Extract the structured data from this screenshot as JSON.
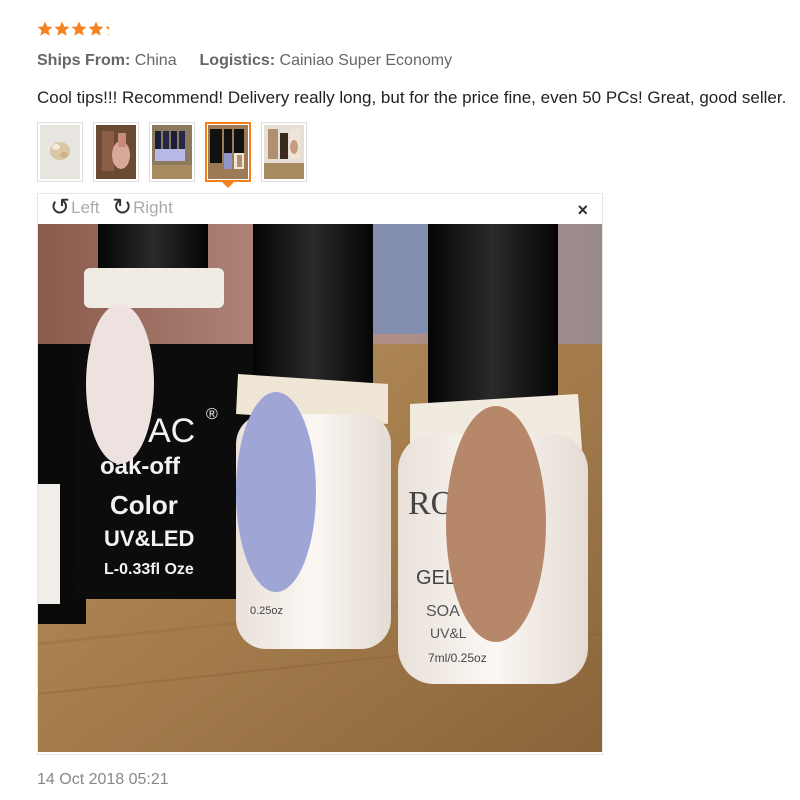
{
  "review": {
    "rating": 4.25,
    "ships_from_label": "Ships From:",
    "ships_from_value": "China",
    "logistics_label": "Logistics:",
    "logistics_value": "Cainiao Super Economy",
    "text": "Cool tips!!! Recommend! Delivery really long, but for the price fine, even 50 PCs! Great, good seller.",
    "date": "14 Oct 2018 05:21"
  },
  "viewer": {
    "rotate_left_label": "Left",
    "rotate_right_label": "Right",
    "close_label": "×",
    "bottle_texts": {
      "brand_partial": "AC",
      "registered": "®",
      "soak_off": "oak-off",
      "color": "Color",
      "uv_led": "UV&LED",
      "volume": "L-0.33fl Oze",
      "brand2": "ROS",
      "gel": "GEL",
      "soa": "SOA",
      "uv_short": "UV&L",
      "ml": "7ml/0.25oz",
      "ml2": "0.25oz"
    }
  },
  "colors": {
    "star": "#f48221",
    "accent_border": "#f48221"
  }
}
